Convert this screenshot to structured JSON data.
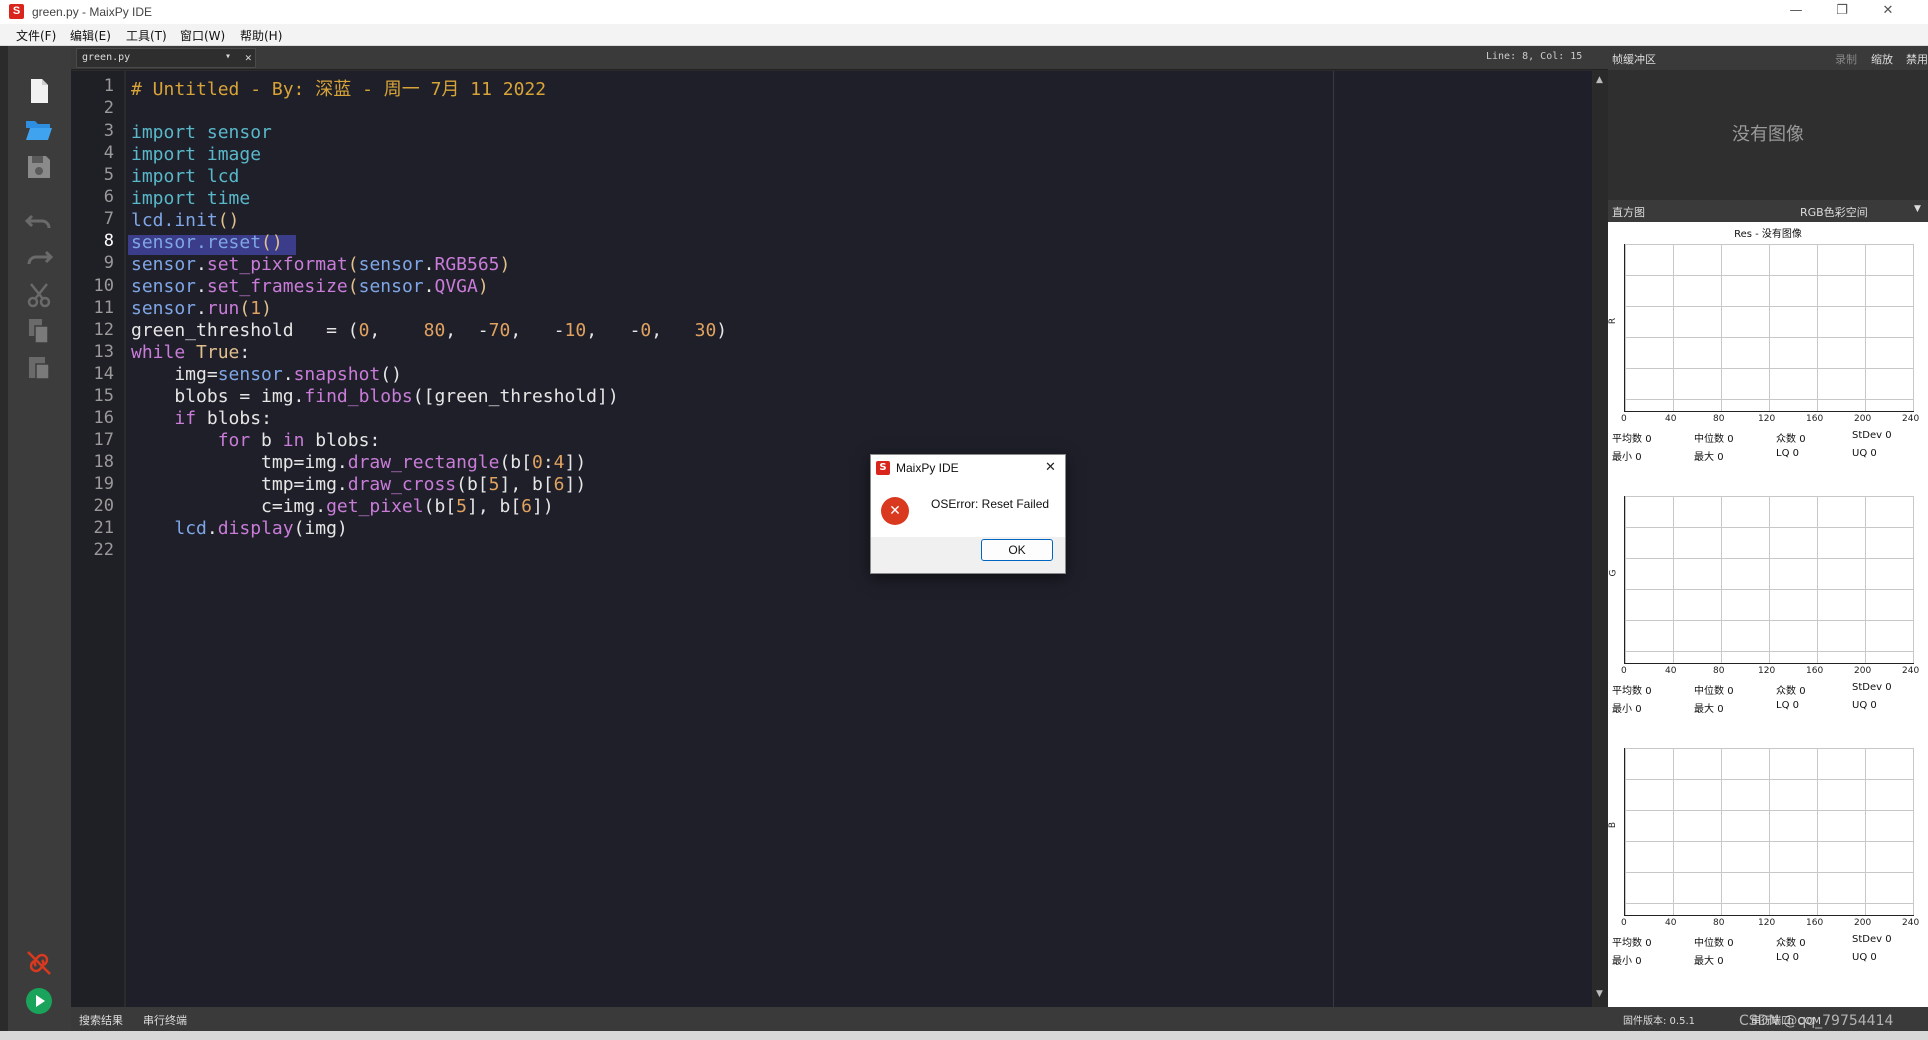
{
  "window": {
    "title": "green.py - MaixPy IDE",
    "logo_letter": "S",
    "minimize": "—",
    "maximize": "❐",
    "close": "✕"
  },
  "menu": [
    "文件(F)",
    "编辑(E)",
    "工具(T)",
    "窗口(W)",
    "帮助(H)"
  ],
  "tab": {
    "name": "green.py",
    "dropdown": "▾",
    "close": "✕"
  },
  "cursor_info": "Line: 8, Col: 15",
  "editor": {
    "current_line": 8,
    "line_numbers": [
      "1",
      "2",
      "3",
      "4",
      "5",
      "6",
      "7",
      "8",
      "9",
      "10",
      "11",
      "12",
      "13",
      "14",
      "15",
      "16",
      "17",
      "18",
      "19",
      "20",
      "21",
      "22"
    ]
  },
  "right_panel": {
    "framebuffer_title": "帧缓冲区",
    "record": "录制",
    "zoom": "缩放",
    "disable": "禁用",
    "no_image": "没有图像",
    "histogram_title": "直方图",
    "color_space": "RGB色彩空间",
    "res_label": "Res - 没有图像",
    "x_ticks": [
      "0",
      "40",
      "80",
      "120",
      "160",
      "200",
      "240"
    ],
    "channels": [
      {
        "label": "R",
        "mean_label": "平均数",
        "mean": "0",
        "median_label": "中位数",
        "median": "0",
        "mode_label": "众数",
        "mode": "0",
        "stdev_label": "StDev",
        "stdev": "0",
        "min_label": "最小",
        "min": "0",
        "max_label": "最大",
        "max": "0",
        "lq_label": "LQ",
        "lq": "0",
        "uq_label": "UQ",
        "uq": "0"
      },
      {
        "label": "G",
        "mean_label": "平均数",
        "mean": "0",
        "median_label": "中位数",
        "median": "0",
        "mode_label": "众数",
        "mode": "0",
        "stdev_label": "StDev",
        "stdev": "0",
        "min_label": "最小",
        "min": "0",
        "max_label": "最大",
        "max": "0",
        "lq_label": "LQ",
        "lq": "0",
        "uq_label": "UQ",
        "uq": "0"
      },
      {
        "label": "B",
        "mean_label": "平均数",
        "mean": "0",
        "median_label": "中位数",
        "median": "0",
        "mode_label": "众数",
        "mode": "0",
        "stdev_label": "StDev",
        "stdev": "0",
        "min_label": "最小",
        "min": "0",
        "max_label": "最大",
        "max": "0",
        "lq_label": "LQ",
        "lq": "0",
        "uq_label": "UQ",
        "uq": "0"
      }
    ]
  },
  "statusbar": {
    "search_results": "搜索结果",
    "serial_terminal": "串行终端",
    "firmware": "固件版本: 0.5.1",
    "serial_port": "串行端口: COM",
    "watermark": "CSDN @qq_79754414"
  },
  "dialog": {
    "title": "MaixPy IDE",
    "message": "OSError: Reset Failed",
    "ok": "OK",
    "close": "✕",
    "error_glyph": "✕"
  },
  "colors": {
    "editor_bg": "#1e1f29",
    "keyword": "#c97cd8",
    "identifier": "#7fa6e6",
    "number": "#e0a260",
    "comment": "#d8a438",
    "error": "#d9391e",
    "run_button": "#1aa35a"
  }
}
